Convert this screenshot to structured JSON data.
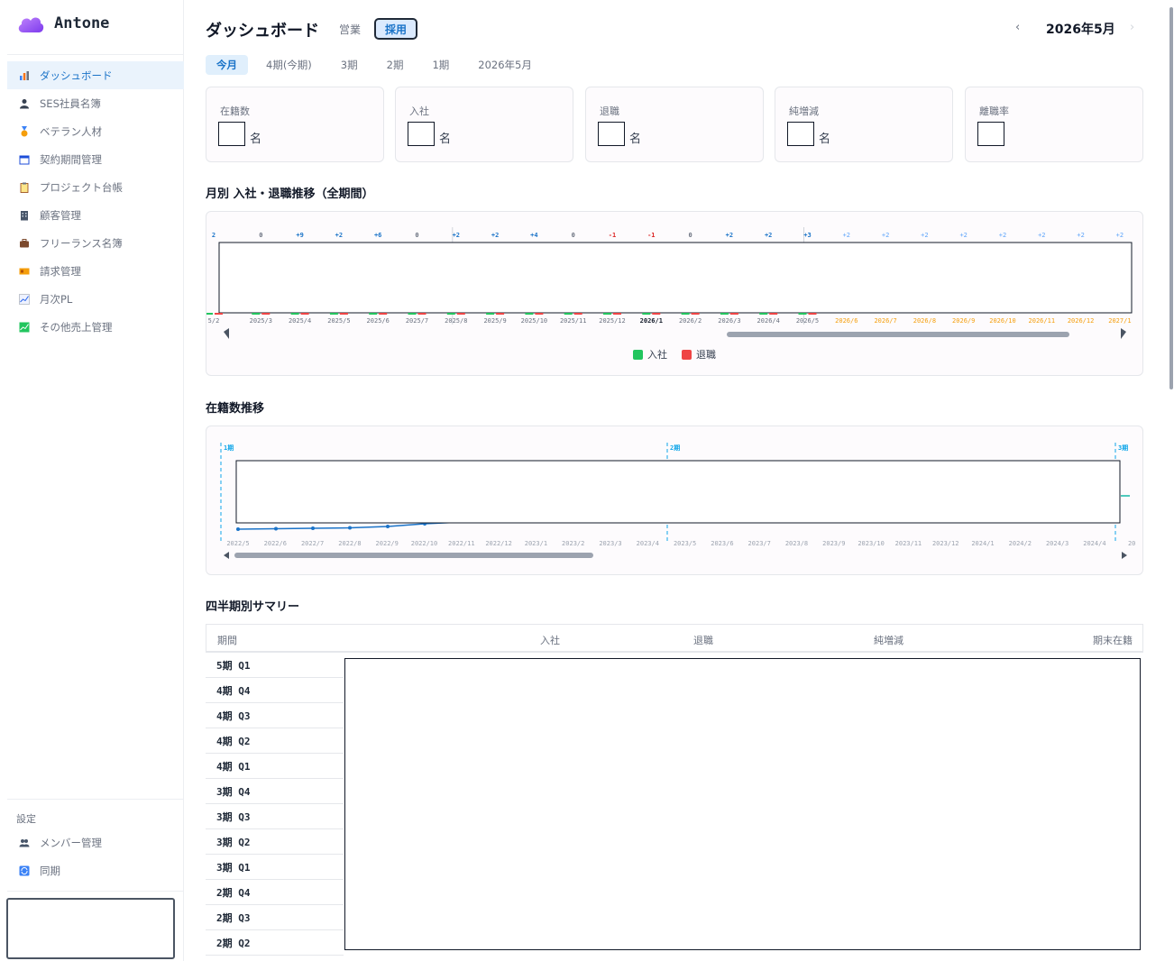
{
  "app": {
    "name": "Antone"
  },
  "sidebar": {
    "items": [
      {
        "label": "ダッシュボード",
        "icon": "bar-chart-icon",
        "active": true
      },
      {
        "label": "SES社員名簿",
        "icon": "person-icon"
      },
      {
        "label": "ベテラン人材",
        "icon": "medal-icon"
      },
      {
        "label": "契約期間管理",
        "icon": "calendar-icon"
      },
      {
        "label": "プロジェクト台帳",
        "icon": "clipboard-icon"
      },
      {
        "label": "顧客管理",
        "icon": "building-icon"
      },
      {
        "label": "フリーランス名簿",
        "icon": "briefcase-icon"
      },
      {
        "label": "請求管理",
        "icon": "invoice-icon"
      },
      {
        "label": "月次PL",
        "icon": "trend-chart-icon"
      },
      {
        "label": "その他売上管理",
        "icon": "growth-chart-icon"
      }
    ],
    "settings_label": "設定",
    "settings_items": [
      {
        "label": "メンバー管理",
        "icon": "people-icon"
      },
      {
        "label": "同期",
        "icon": "sync-icon"
      }
    ]
  },
  "header": {
    "title": "ダッシュボード",
    "mode_sales": "営業",
    "mode_hire": "採用",
    "prev": "‹",
    "month": "2026年5月",
    "next": "›"
  },
  "period_tabs": [
    "今月",
    "4期(今期)",
    "3期",
    "2期",
    "1期",
    "2026年5月"
  ],
  "kpis": [
    {
      "label": "在籍数",
      "unit": "名"
    },
    {
      "label": "入社",
      "unit": "名"
    },
    {
      "label": "退職",
      "unit": "名"
    },
    {
      "label": "純増減",
      "unit": "名"
    },
    {
      "label": "離職率",
      "unit": ""
    }
  ],
  "sections": {
    "monthly_title": "月別 入社・退職推移（全期間）",
    "headcount_title": "在籍数推移",
    "quarterly_title": "四半期別サマリー"
  },
  "chart_data": [
    {
      "type": "bar",
      "categories": [
        "5/2",
        "2025/3",
        "2025/4",
        "2025/5",
        "2025/6",
        "2025/7",
        "2025/8",
        "2025/9",
        "2025/10",
        "2025/11",
        "2025/12",
        "2026/1",
        "2026/2",
        "2026/3",
        "2026/4",
        "2026/5",
        "2026/6",
        "2026/7",
        "2026/8",
        "2026/9",
        "2026/10",
        "2026/11",
        "2026/12",
        "2027/1"
      ],
      "net_labels": [
        "2",
        "0",
        "+9",
        "+2",
        "+6",
        "0",
        "+2",
        "+2",
        "+4",
        "0",
        "-1",
        "-1",
        "0",
        "+2",
        "+2",
        "+3",
        "+2",
        "+2",
        "+2",
        "+2",
        "+2",
        "+2",
        "+2",
        "+2"
      ],
      "legend": [
        "入社",
        "退職"
      ],
      "colors": {
        "hire": "#22c55e",
        "leave": "#ef4444",
        "positive": "#1a73c8",
        "negative": "#dc2626",
        "future": "#f59e0b"
      },
      "legend_position": "bottom"
    },
    {
      "type": "line",
      "categories": [
        "2022/5",
        "2022/6",
        "2022/7",
        "2022/8",
        "2022/9",
        "2022/10",
        "2022/11",
        "2022/12",
        "2023/1",
        "2023/2",
        "2023/3",
        "2023/4",
        "2023/5",
        "2023/6",
        "2023/7",
        "2023/8",
        "2023/9",
        "2023/10",
        "2023/11",
        "2023/12",
        "2024/1",
        "2024/2",
        "2024/3",
        "2024/4",
        "20"
      ],
      "period_markers": [
        {
          "label": "1期",
          "index": 0
        },
        {
          "label": "2期",
          "index": 12
        },
        {
          "label": "3期",
          "index": 24
        }
      ],
      "color": "#1a73c8"
    }
  ],
  "quarterly": {
    "headers": [
      "期間",
      "入社",
      "退職",
      "純増減",
      "期末在籍"
    ],
    "rows": [
      "5期 Q1",
      "4期 Q4",
      "4期 Q3",
      "4期 Q2",
      "4期 Q1",
      "3期 Q4",
      "3期 Q3",
      "3期 Q2",
      "3期 Q1",
      "2期 Q4",
      "2期 Q3",
      "2期 Q2"
    ]
  }
}
